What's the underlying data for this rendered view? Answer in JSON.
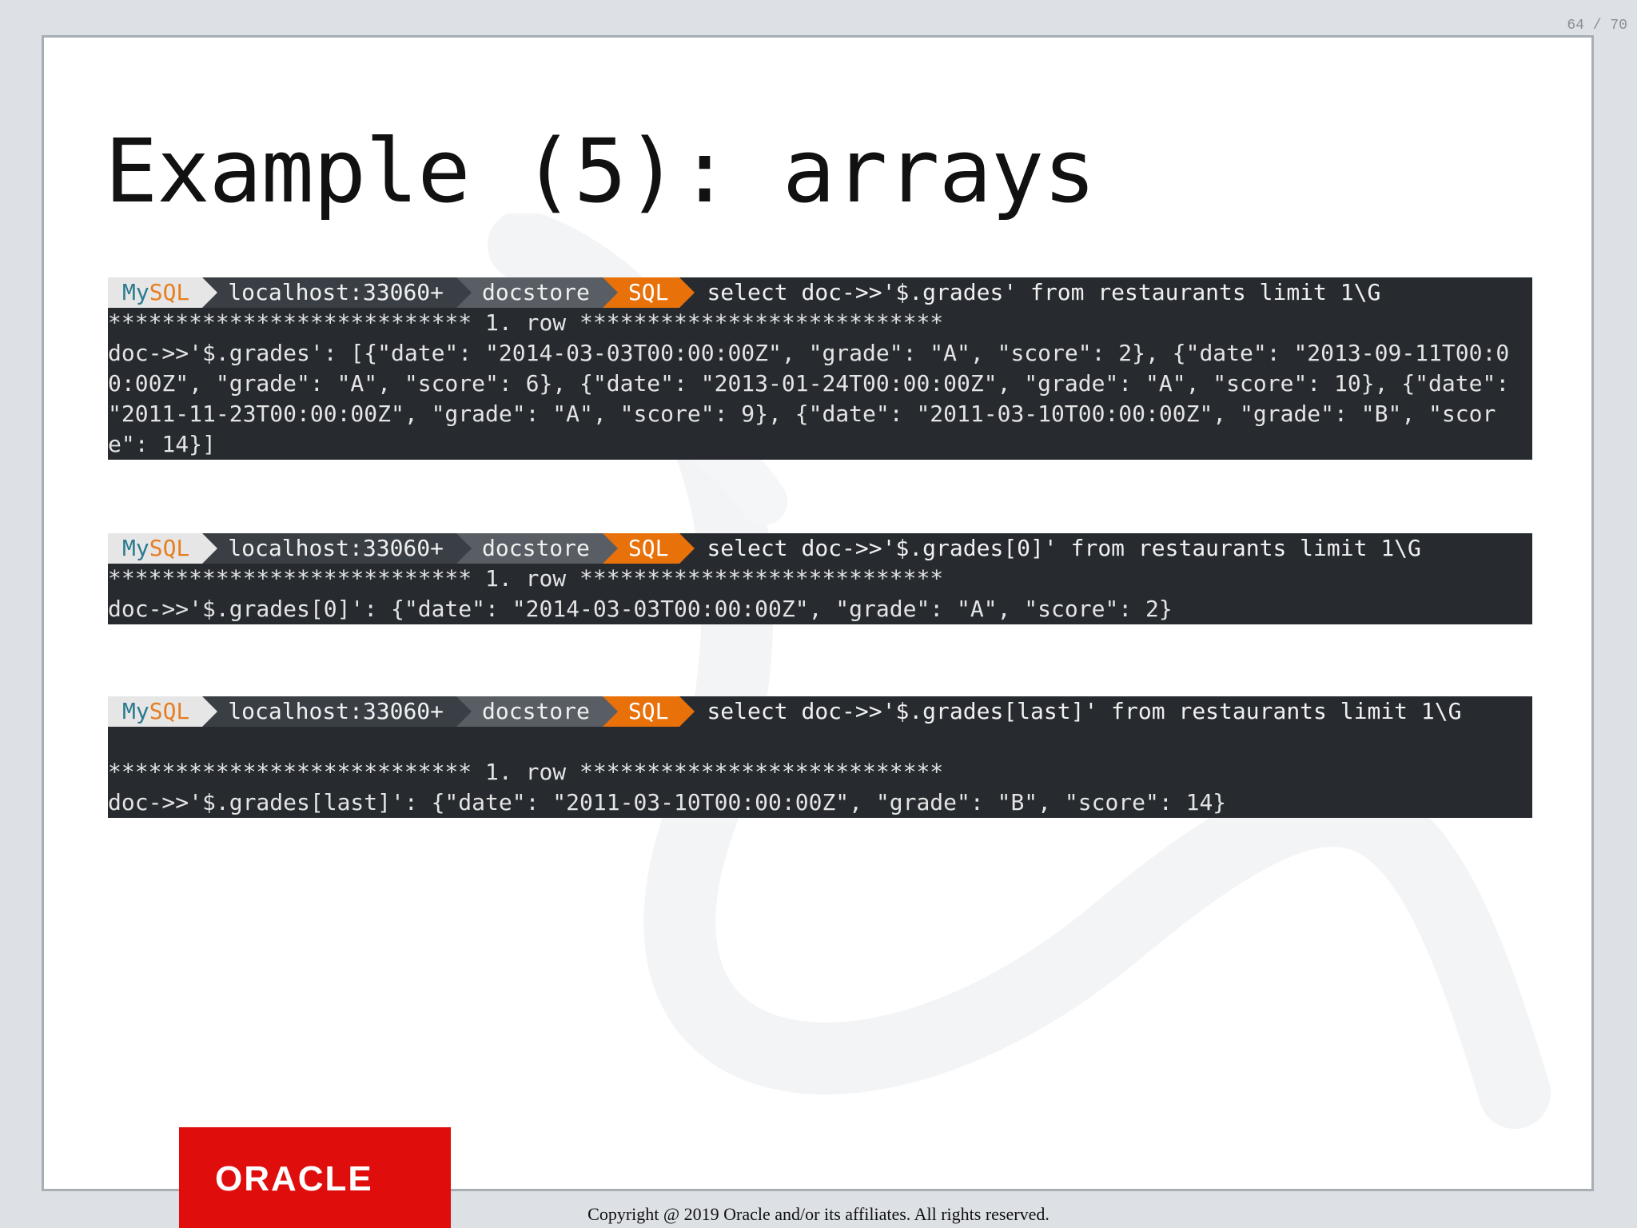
{
  "page_counter": "64 / 70",
  "title": "Example (5): arrays",
  "prompt": {
    "mysql_left": "My",
    "mysql_right": "SQL",
    "host": "localhost:33060+",
    "db": "docstore",
    "mode": "SQL"
  },
  "terminals": [
    {
      "command": "select doc->>'$.grades' from restaurants limit 1\\G",
      "row_line": "*************************** 1. row ***************************",
      "output": "doc->>'$.grades': [{\"date\": \"2014-03-03T00:00:00Z\", \"grade\": \"A\", \"score\": 2}, {\"date\": \"2013-09-11T00:00:00Z\", \"grade\": \"A\", \"score\": 6}, {\"date\": \"2013-01-24T00:00:00Z\", \"grade\": \"A\", \"score\": 10}, {\"date\": \"2011-11-23T00:00:00Z\", \"grade\": \"A\", \"score\": 9}, {\"date\": \"2011-03-10T00:00:00Z\", \"grade\": \"B\", \"score\": 14}]"
    },
    {
      "command": "select doc->>'$.grades[0]' from restaurants limit 1\\G",
      "row_line": "*************************** 1. row ***************************",
      "output": "doc->>'$.grades[0]': {\"date\": \"2014-03-03T00:00:00Z\", \"grade\": \"A\", \"score\": 2}"
    },
    {
      "command": "select doc->>'$.grades[last]' from restaurants limit 1\\G",
      "row_line": "*************************** 1. row ***************************",
      "output": "doc->>'$.grades[last]': {\"date\": \"2011-03-10T00:00:00Z\", \"grade\": \"B\", \"score\": 14}"
    }
  ],
  "logo_text": "ORACLE",
  "copyright": "Copyright @ 2019 Oracle and/or its affiliates. All rights reserved.",
  "colors": {
    "terminal_bg": "#272b30",
    "accent_orange": "#e8710a",
    "oracle_red": "#e00d0d"
  }
}
